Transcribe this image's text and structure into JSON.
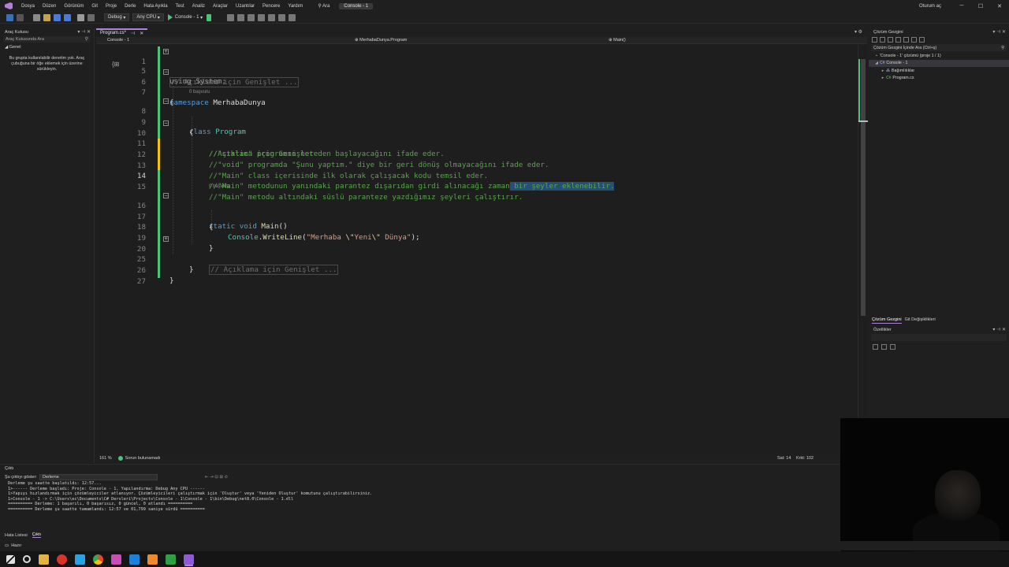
{
  "menu": {
    "items": [
      "Dosya",
      "Düzen",
      "Görünüm",
      "Git",
      "Proje",
      "Derle",
      "Hata Ayıkla",
      "Test",
      "Analiz",
      "Araçlar",
      "Uzantılar",
      "Pencere",
      "Yardım"
    ],
    "search_label": "Ara",
    "solution_title": "Console - 1",
    "user_label": "Oturum aç"
  },
  "toolbar": {
    "config": "Debug",
    "platform": "Any CPU",
    "run_label": "Console - 1"
  },
  "toolbox": {
    "title": "Araç Kutusu",
    "search_placeholder": "Araç Kutusunda Ara",
    "group": "Genel",
    "empty_text": "Bu grupta kullanılabilir denetim yok. Araç çubuğuna bir öğe eklemek için üzerine sürükleyin."
  },
  "editor": {
    "tab_label": "Program.cs*",
    "nav_project": "Console - 1",
    "nav_class": "MerhabaDunya.Program",
    "nav_member": "Main()",
    "references_label": "0 başvuru",
    "lines": {
      "l1": "// Açıklama için Genişlet ...",
      "l5": "using System;",
      "l6_kw": "namespace",
      "l6_name": " MerhabaDunya",
      "l7": "{",
      "l8_kw": "class",
      "l8_name": " Program",
      "l9": "{",
      "l10": "//Açıklama için Genişlet",
      "l11": "//\"static\" programın nereden başlayacağını ifade eder.",
      "l12": "//\"void\" programda \"Şunu yaptım.\" diye bir geri dönüş olmayacağını ifade eder.",
      "l13": "//\"Main\" class içerisinde ilk olarak çalışacak kodu temsil eder.",
      "l14_a": "//\"Main\" metodunun yanındaki parantez dışarıdan girdi alınacağı zaman",
      "l14_b": " bir şeyler eklenebilir.",
      "l15": "//\"Main\" metodu altındaki süslü paranteze yazdığımız şeyleri çalıştırır.",
      "l16_kw": "static void",
      "l16_fn": " Main",
      "l16_p": "()",
      "l17": "{",
      "l18_cls": "Console",
      "l18_dot": ".",
      "l18_fn": "WriteLine",
      "l18_open": "(",
      "l18_s1": "\"Merhaba ",
      "l18_e1": "\\\"",
      "l18_s2": "Yeni",
      "l18_e2": "\\\"",
      "l18_s3": " Dünya\"",
      "l18_close": ");",
      "l19": "}",
      "l20": "// Açıklama için Genişlet ...",
      "l25": "}",
      "l26": "}",
      "l27": ""
    },
    "line_numbers": [
      "1",
      "5",
      "6",
      "7",
      "8",
      "9",
      "10",
      "11",
      "12",
      "13",
      "14",
      "15",
      "16",
      "17",
      "18",
      "19",
      "20",
      "25",
      "26",
      "27"
    ]
  },
  "editor_status": {
    "zoom": "161 %",
    "issues": "Sorun bulunamadı",
    "line": "Sat: 14",
    "char": "Krkt: 102"
  },
  "solution_explorer": {
    "title": "Çözüm Gezgini",
    "search_placeholder": "Çözüm Gezgini İçinde Ara (Ctrl+ş)",
    "solution": "'Console - 1' çözümü (proje 1 / 1)",
    "project": "Console - 1",
    "dependencies": "Bağımlılıklar",
    "file": "Program.cs",
    "tab_solution": "Çözüm Gezgini",
    "tab_git": "Git Değişiklikleri"
  },
  "properties": {
    "title": "Özellikler"
  },
  "output": {
    "title": "Çıktı",
    "source_label": "Şu çıktıyı göster:",
    "source_value": "Derleme",
    "lines": [
      "Derleme şu saatte başlatıldı: 12:57...",
      "1>------ Derleme başladı: Proje: Console - 1, Yapılandırma: Debug Any CPU ------",
      "1>Yapıyı hızlandırmak için çözümleyiciler atlanıyor. Çözümleyicileri çalıştırmak için 'Oluştur' veya 'Yeniden Oluştur' komutunu çalıştırabilirsiniz.",
      "1>Console - 1 -> C:\\Users\\ec\\Documents\\C# Dersleri\\Projects\\Console - 1\\Console - 1\\bin\\Debug\\net8.0\\Console - 1.dll",
      "========== Derleme: 1 başarılı, 0 başarısız, 0 güncel, 0 atlandı ==========",
      "========== Derleme şu saatte tamamlandı: 12:57 ve 01,799 saniye sürdü =========="
    ]
  },
  "bottom_tabs": [
    "Hata Listesi",
    "Çıktı"
  ],
  "status_bar": {
    "text": "Hazır"
  },
  "colors": {
    "accent": "#b180d7",
    "comment": "#57a64a",
    "keyword": "#569cd6",
    "type": "#4ec9b0",
    "method": "#dcdcaa",
    "string": "#d69d85"
  }
}
